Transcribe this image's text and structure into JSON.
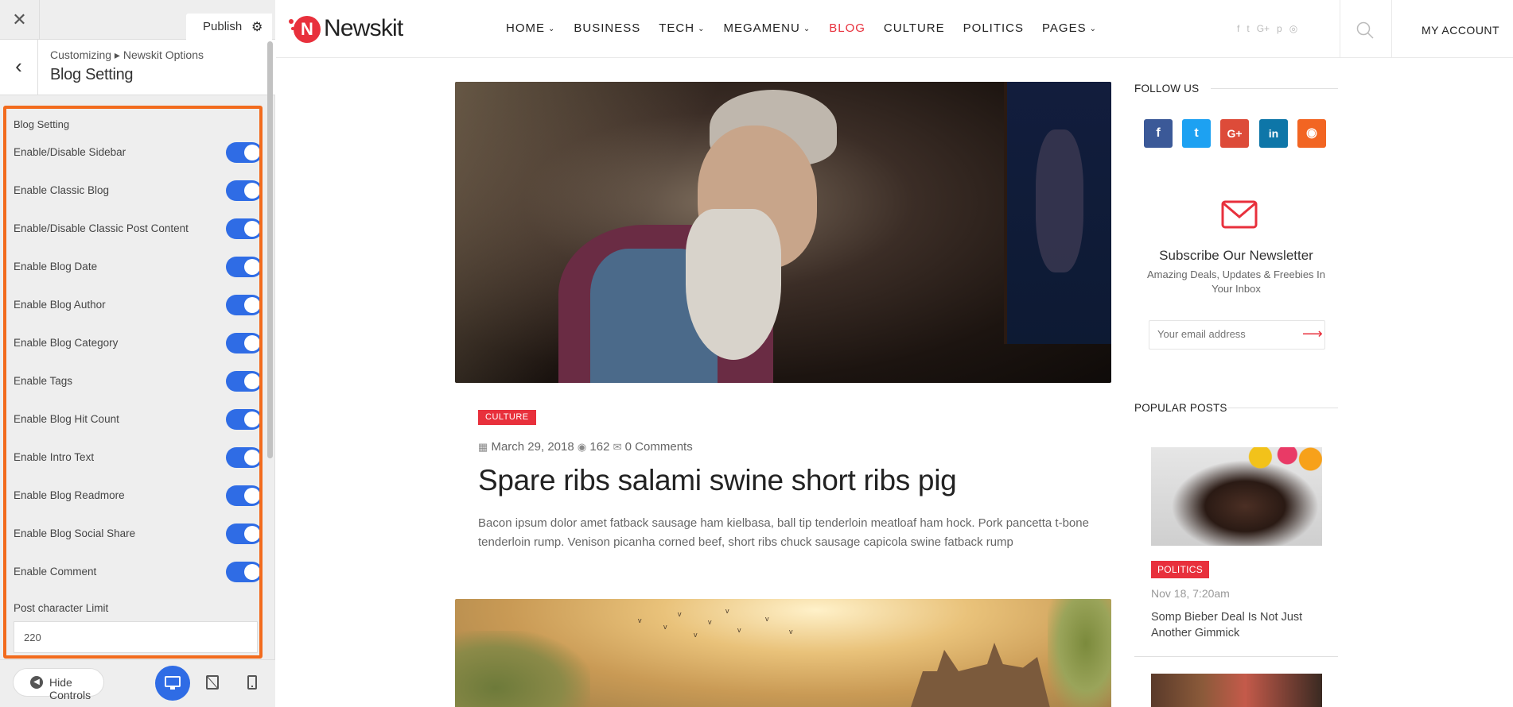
{
  "customizer": {
    "close_glyph": "✕",
    "publish_label": "Publish",
    "breadcrumb": "Customizing ▸ Newskit Options",
    "section_title": "Blog Setting",
    "panel_heading": "Blog Setting",
    "toggles": [
      {
        "label": "Enable/Disable Sidebar",
        "on": true
      },
      {
        "label": "Enable Classic Blog",
        "on": true
      },
      {
        "label": "Enable/Disable Classic Post Content",
        "on": true
      },
      {
        "label": "Enable Blog Date",
        "on": true
      },
      {
        "label": "Enable Blog Author",
        "on": true
      },
      {
        "label": "Enable Blog Category",
        "on": true
      },
      {
        "label": "Enable Tags",
        "on": true
      },
      {
        "label": "Enable Blog Hit Count",
        "on": true
      },
      {
        "label": "Enable Intro Text",
        "on": true
      },
      {
        "label": "Enable Blog Readmore",
        "on": true
      },
      {
        "label": "Enable Blog Social Share",
        "on": true
      },
      {
        "label": "Enable Comment",
        "on": true
      }
    ],
    "post_char_limit_label": "Post character Limit",
    "post_char_limit_value": "220",
    "hide_controls_label": "Hide Controls",
    "accent_color": "#2f6ce5",
    "highlight_color": "#f26b1d"
  },
  "site": {
    "logo_letter": "N",
    "logo_text": "Newskit",
    "brand_color": "#e8303c",
    "menu": [
      {
        "label": "HOME",
        "caret": true
      },
      {
        "label": "BUSINESS",
        "caret": false
      },
      {
        "label": "TECH",
        "caret": true
      },
      {
        "label": "MEGAMENU",
        "caret": true
      },
      {
        "label": "BLOG",
        "caret": false,
        "active": true
      },
      {
        "label": "CULTURE",
        "caret": false
      },
      {
        "label": "POLITICS",
        "caret": false
      },
      {
        "label": "PAGES",
        "caret": true
      }
    ],
    "social_icons_top": [
      "f",
      "t",
      "G+",
      "p",
      "◎"
    ],
    "account_label": "MY ACCOUNT",
    "post": {
      "category": "CULTURE",
      "date": "March 29, 2018",
      "views": "162",
      "comments": "0 Comments",
      "title": "Spare ribs salami swine short ribs pig",
      "excerpt": "Bacon ipsum dolor amet fatback sausage ham kielbasa, ball tip tenderloin meatloaf ham hock. Pork pancetta t-bone tenderloin rump. Venison picanha corned beef, short ribs chuck sausage capicola swine fatback rump"
    },
    "sidebar": {
      "follow_heading": "FOLLOW US",
      "socials": [
        {
          "name": "facebook",
          "glyph": "f",
          "color": "#3b5998"
        },
        {
          "name": "twitter",
          "glyph": "t",
          "color": "#1da1f2"
        },
        {
          "name": "google-plus",
          "glyph": "G+",
          "color": "#dd4b39"
        },
        {
          "name": "linkedin",
          "glyph": "in",
          "color": "#0e76a8"
        },
        {
          "name": "rss",
          "glyph": "◉",
          "color": "#f26522"
        }
      ],
      "newsletter_title": "Subscribe Our Newsletter",
      "newsletter_sub": "Amazing Deals, Updates & Freebies In Your Inbox",
      "email_placeholder": "Your email address",
      "popular_heading": "POPULAR POSTS",
      "popular": {
        "category": "POLITICS",
        "date": "Nov 18, 7:20am",
        "title": "Somp Bieber Deal Is Not Just Another Gimmick"
      }
    }
  }
}
